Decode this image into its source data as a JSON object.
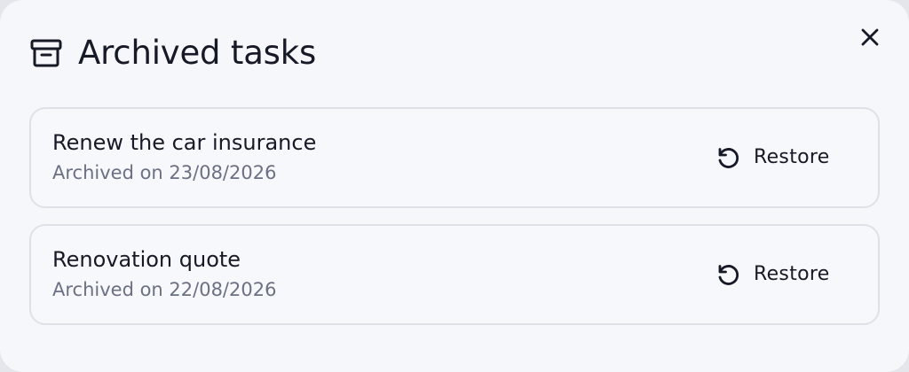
{
  "dialog": {
    "title": "Archived tasks",
    "title_icon": "archive-box-icon",
    "close_icon": "close-icon"
  },
  "tasks": [
    {
      "title": "Renew the car insurance",
      "archived_text": "Archived on 23/08/2026",
      "action_label": "Restore",
      "action_icon": "restore-icon"
    },
    {
      "title": "Renovation quote",
      "archived_text": "Archived on 22/08/2026",
      "action_label": "Restore",
      "action_icon": "restore-icon"
    }
  ],
  "colors": {
    "background": "#f6f7fb",
    "text_primary": "#161a26",
    "text_secondary": "#6b7183",
    "card_border": "#dfe1e8"
  }
}
